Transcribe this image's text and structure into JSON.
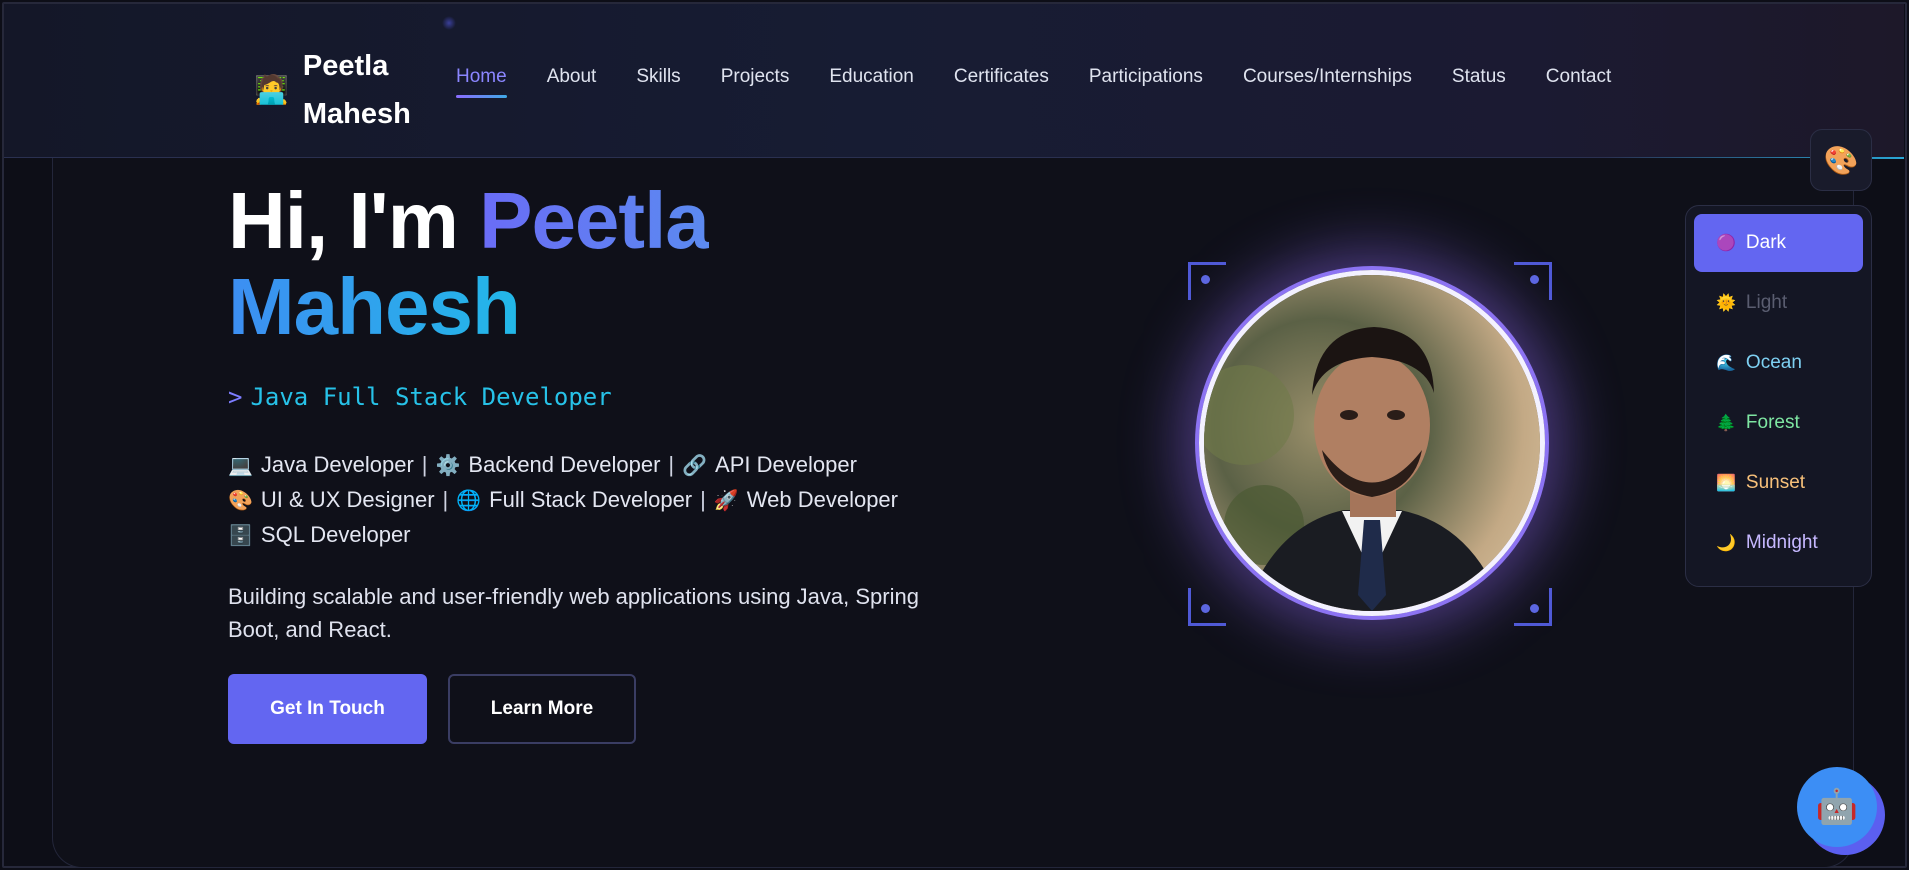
{
  "brand": {
    "emoji": "🧑‍💻",
    "name": "Peetla Mahesh"
  },
  "nav": {
    "items": [
      {
        "label": "Home",
        "active": true
      },
      {
        "label": "About"
      },
      {
        "label": "Skills"
      },
      {
        "label": "Projects"
      },
      {
        "label": "Education"
      },
      {
        "label": "Certificates"
      },
      {
        "label": "Participations"
      },
      {
        "label": "Courses/Internships"
      },
      {
        "label": "Status"
      },
      {
        "label": "Contact"
      }
    ]
  },
  "hero": {
    "greeting": "Hi, I'm",
    "name_first": "Peetla",
    "name_last": "Mahesh",
    "prompt": ">",
    "role": "Java Full Stack Developer",
    "skills": [
      {
        "icon": "💻",
        "label": "Java Developer"
      },
      {
        "icon": "⚙️",
        "label": "Backend Developer"
      },
      {
        "icon": "🔗",
        "label": "API Developer"
      },
      {
        "icon": "🎨",
        "label": "UI & UX Designer"
      },
      {
        "icon": "🌐",
        "label": "Full Stack Developer"
      },
      {
        "icon": "🚀",
        "label": "Web Developer"
      },
      {
        "icon": "🗄️",
        "label": "SQL Developer"
      }
    ],
    "separator": "|",
    "tagline": "Building scalable and user-friendly web applications using Java, Spring Boot, and React.",
    "cta_primary": "Get In Touch",
    "cta_secondary": "Learn More"
  },
  "theme_switcher": {
    "button_icon": "🎨",
    "options": [
      {
        "icon": "🟣",
        "label": "Dark",
        "color": "#ffffff",
        "active": true
      },
      {
        "icon": "🌞",
        "label": "Light",
        "color": "#5a5d70"
      },
      {
        "icon": "🌊",
        "label": "Ocean",
        "color": "#7ed0f2"
      },
      {
        "icon": "🌲",
        "label": "Forest",
        "color": "#7ee6a2"
      },
      {
        "icon": "🌅",
        "label": "Sunset",
        "color": "#f7c07a"
      },
      {
        "icon": "🌙",
        "label": "Midnight",
        "color": "#c6b8ff"
      }
    ]
  },
  "chatbot": {
    "icon": "🤖"
  },
  "colors": {
    "accent": "#6366f1",
    "cyan": "#22b8e8",
    "background": "#0d0e17"
  }
}
